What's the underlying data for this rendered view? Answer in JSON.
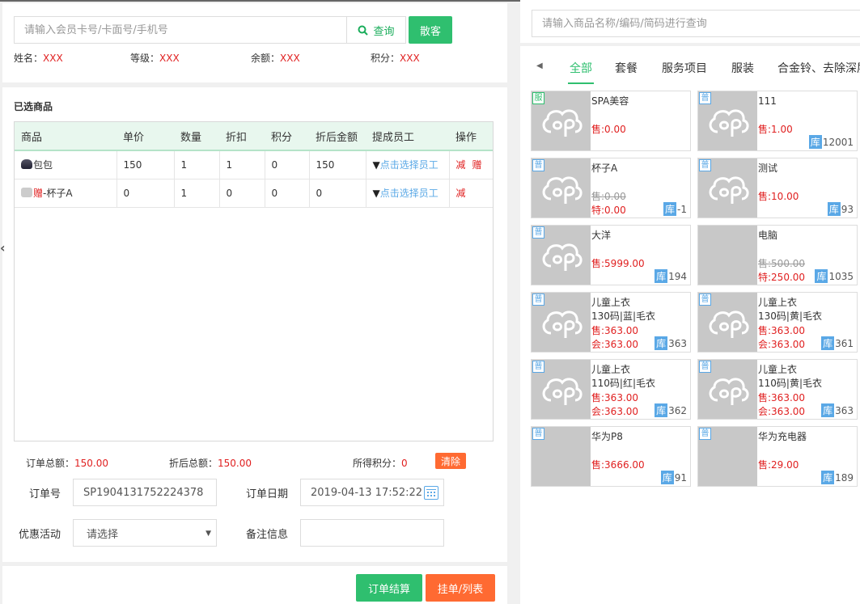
{
  "member": {
    "search_placeholder": "请输入会员卡号/卡面号/手机号",
    "query_label": "查询",
    "guest_label": "散客",
    "info": [
      {
        "label": "姓名：",
        "value": "XXX"
      },
      {
        "label": "等级：",
        "value": "XXX"
      },
      {
        "label": "余额：",
        "value": "XXX"
      },
      {
        "label": "积分：",
        "value": "XXX"
      }
    ]
  },
  "selected": {
    "title": "已选商品",
    "headers": [
      "商品",
      "单价",
      "数量",
      "折扣",
      "积分",
      "折后金额",
      "提成员工",
      "操作"
    ],
    "rows": [
      {
        "name": "包包",
        "gift_prefix": "",
        "price": "150",
        "qty": "1",
        "discount": "1",
        "points": "0",
        "amount": "150",
        "employee": "▼点击选择员工",
        "ops": [
          "减",
          "赠"
        ]
      },
      {
        "name": "-杯子A",
        "gift_prefix": "赠",
        "price": "0",
        "qty": "1",
        "discount": "0",
        "points": "0",
        "amount": "0",
        "employee": "▼点击选择员工",
        "ops": [
          "减"
        ]
      }
    ]
  },
  "summary": {
    "total_label": "订单总额：",
    "total_value": "150.00",
    "discounted_label": "折后总额：",
    "discounted_value": "150.00",
    "points_label": "所得积分：",
    "points_value": "0",
    "clear_label": "清除"
  },
  "form": {
    "order_no_label": "订单号",
    "order_no": "SP1904131752224378",
    "order_date_label": "订单日期",
    "order_date": "2019-04-13 17:52:22",
    "promo_label": "优惠活动",
    "promo_value": "请选择",
    "remark_label": "备注信息",
    "remark_value": ""
  },
  "actions": {
    "settle": "订单结算",
    "hang": "挂单/列表"
  },
  "goods": {
    "search_placeholder": "请输入商品名称/编码/简码进行查询",
    "tabs": [
      "全部",
      "套餐",
      "服务项目",
      "服装",
      "合金铃、去除深层"
    ],
    "active_tab": "全部",
    "stock_label": "库",
    "items": [
      {
        "tag": "服",
        "name": "SPA美容",
        "p1": "售:0.00",
        "p1_strike": false,
        "p2": "",
        "stock": ""
      },
      {
        "tag": "普",
        "name": "111",
        "p1": "售:1.00",
        "p1_strike": false,
        "p2": "",
        "stock": "12001"
      },
      {
        "tag": "普",
        "name": "杯子A",
        "p1": "售:0.00",
        "p1_strike": true,
        "p2": "特:0.00",
        "stock": "-1"
      },
      {
        "tag": "普",
        "name": "测试",
        "p1": "售:10.00",
        "p1_strike": false,
        "p2": "",
        "stock": "93"
      },
      {
        "tag": "普",
        "name": "大洋",
        "p1": "售:5999.00",
        "p1_strike": false,
        "p2": "",
        "stock": "194"
      },
      {
        "tag": "",
        "name": "电脑",
        "p1": "售:500.00",
        "p1_strike": true,
        "p2": "特:250.00",
        "stock": "1035",
        "photo": "laptop"
      },
      {
        "tag": "普",
        "name": "儿童上衣",
        "sub": "130码|蓝|毛衣",
        "p1": "售:363.00",
        "p1_strike": false,
        "p2": "会:363.00",
        "stock": "363"
      },
      {
        "tag": "普",
        "name": "儿童上衣",
        "sub": "130码|黄|毛衣",
        "p1": "售:363.00",
        "p1_strike": false,
        "p2": "会:363.00",
        "stock": "361"
      },
      {
        "tag": "普",
        "name": "儿童上衣",
        "sub": "110码|红|毛衣",
        "p1": "售:363.00",
        "p1_strike": false,
        "p2": "会:363.00",
        "stock": "362"
      },
      {
        "tag": "普",
        "name": "儿童上衣",
        "sub": "110码|黄|毛衣",
        "p1": "售:363.00",
        "p1_strike": false,
        "p2": "会:363.00",
        "stock": "363"
      },
      {
        "tag": "普",
        "name": "华为P8",
        "p1": "售:3666.00",
        "p1_strike": false,
        "p2": "",
        "stock": "91",
        "photo": "phone"
      },
      {
        "tag": "普",
        "name": "华为充电器",
        "p1": "售:29.00",
        "p1_strike": false,
        "p2": "",
        "stock": "189",
        "photo": "charger"
      }
    ]
  },
  "colors": {
    "green": "#2fbf6f",
    "orange": "#ff6a32",
    "red": "#e02020",
    "blue": "#5aa8e6"
  }
}
